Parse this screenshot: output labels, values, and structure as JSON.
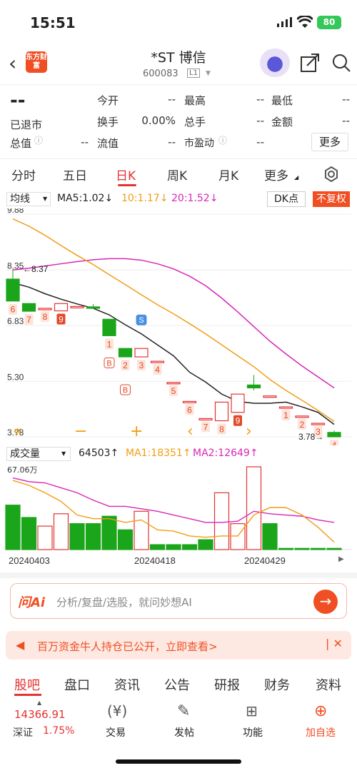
{
  "status": {
    "time": "15:51",
    "battery": "80"
  },
  "header": {
    "title": "*ST 博信",
    "code": "600083",
    "level": "L1",
    "logo_text": "东方财富"
  },
  "quote": {
    "price": "--",
    "status_text": "已退市",
    "fields": [
      {
        "label": "今开",
        "value": "--"
      },
      {
        "label": "最高",
        "value": "--"
      },
      {
        "label": "最低",
        "value": "--"
      },
      {
        "label": "换手",
        "value": "0.00%"
      },
      {
        "label": "总手",
        "value": "--"
      },
      {
        "label": "金额",
        "value": "--"
      },
      {
        "label": "总值",
        "value": "--"
      },
      {
        "label": "流值",
        "value": "--"
      },
      {
        "label": "市盈动",
        "value": "--"
      }
    ],
    "more_label": "更多"
  },
  "period_tabs": [
    "分时",
    "五日",
    "日K",
    "周K",
    "月K",
    "更多"
  ],
  "active_tab": "日K",
  "chart_controls": {
    "indicator": "均线",
    "ma5": "MA5:1.02↓",
    "ma10": "10:1.17↓",
    "ma20": "20:1.52↓",
    "dk": "DK点",
    "adjust": "不复权"
  },
  "volume_controls": {
    "indicator": "成交量",
    "vol": "64503↑",
    "ma1": "MA1:18351↑",
    "ma2": "MA2:12649↑",
    "max_label": "67.06万"
  },
  "chart_data": [
    {
      "type": "candlestick",
      "title": "",
      "price_axis_labels": [
        "9.88",
        "8.35",
        "6.83",
        "5.30",
        "3.78"
      ],
      "annotations": {
        "high_marker": "8.37",
        "low_marker": "3.78"
      },
      "candles": [
        {
          "open": 8.1,
          "high": 8.37,
          "low": 7.5,
          "close": 7.5,
          "label": "6"
        },
        {
          "open": 7.43,
          "high": 7.43,
          "low": 7.22,
          "close": 7.22,
          "label": "7"
        },
        {
          "open": 7.3,
          "high": 7.3,
          "low": 7.3,
          "close": 7.3,
          "label": "8"
        },
        {
          "open": 7.23,
          "high": 7.43,
          "low": 7.23,
          "close": 7.43,
          "label": "9"
        },
        {
          "open": 7.35,
          "high": 7.35,
          "low": 7.35,
          "close": 7.35,
          "label": ""
        },
        {
          "open": 7.34,
          "high": 7.42,
          "low": 7.3,
          "close": 7.3,
          "label": ""
        },
        {
          "open": 7.0,
          "high": 7.0,
          "low": 6.55,
          "close": 6.55,
          "label": "1"
        },
        {
          "open": 6.2,
          "high": 6.2,
          "low": 5.97,
          "close": 5.97,
          "label": "2"
        },
        {
          "open": 5.97,
          "high": 6.2,
          "low": 5.97,
          "close": 6.2,
          "label": "3"
        },
        {
          "open": 5.85,
          "high": 5.85,
          "low": 5.85,
          "close": 5.85,
          "label": "4"
        },
        {
          "open": 5.27,
          "high": 5.27,
          "low": 5.27,
          "close": 5.27,
          "label": "5"
        },
        {
          "open": 4.75,
          "high": 4.75,
          "low": 4.75,
          "close": 4.75,
          "label": "6"
        },
        {
          "open": 4.28,
          "high": 4.28,
          "low": 4.28,
          "close": 4.28,
          "label": "7"
        },
        {
          "open": 4.22,
          "high": 4.73,
          "low": 4.22,
          "close": 4.73,
          "label": "8"
        },
        {
          "open": 4.45,
          "high": 4.95,
          "low": 4.45,
          "close": 4.95,
          "label": "9"
        },
        {
          "open": 5.2,
          "high": 5.47,
          "low": 5.05,
          "close": 5.12,
          "label": ""
        },
        {
          "open": 4.9,
          "high": 4.9,
          "low": 4.9,
          "close": 4.9,
          "label": ""
        },
        {
          "open": 4.6,
          "high": 4.6,
          "low": 4.6,
          "close": 4.6,
          "label": "1"
        },
        {
          "open": 4.35,
          "high": 4.35,
          "low": 4.35,
          "close": 4.35,
          "label": "2"
        },
        {
          "open": 4.15,
          "high": 4.15,
          "low": 4.15,
          "close": 4.15,
          "label": "3"
        },
        {
          "open": 3.9,
          "high": 3.95,
          "low": 3.78,
          "close": 3.78,
          "label": "4"
        }
      ],
      "ma5": [
        8.0,
        7.88,
        7.7,
        7.55,
        7.42,
        7.3,
        7.12,
        6.85,
        6.6,
        6.3,
        6.0,
        5.55,
        5.28,
        4.95,
        4.75,
        4.7,
        4.7,
        4.73,
        4.6,
        4.45,
        4.12
      ],
      "ma10": [
        9.75,
        9.55,
        9.3,
        9.02,
        8.75,
        8.5,
        8.22,
        7.95,
        7.67,
        7.4,
        7.15,
        6.88,
        6.6,
        6.3,
        6.0,
        5.7,
        5.35,
        5.05,
        4.78,
        4.5,
        4.2
      ],
      "ma20": [
        8.35,
        8.4,
        8.46,
        8.52,
        8.58,
        8.63,
        8.66,
        8.66,
        8.62,
        8.52,
        8.38,
        8.18,
        7.92,
        7.58,
        7.2,
        6.8,
        6.4,
        6.05,
        5.72,
        5.42,
        5.12
      ],
      "signals": [
        "B",
        "B",
        "S"
      ]
    },
    {
      "type": "bar",
      "title": "",
      "ylabel_max": "67.06万",
      "x_tick_labels": [
        "20240403",
        "20240418",
        "20240429"
      ],
      "values": [
        36,
        26,
        19,
        29,
        21,
        21,
        27,
        16,
        31,
        4,
        4,
        4,
        8,
        46,
        21,
        67,
        21,
        1,
        1,
        1,
        1
      ],
      "up": [
        false,
        false,
        true,
        true,
        false,
        false,
        false,
        false,
        true,
        false,
        false,
        false,
        false,
        true,
        true,
        true,
        false,
        false,
        false,
        false,
        false
      ],
      "ma1": [
        56,
        52,
        46,
        39,
        28,
        25,
        25,
        22,
        24,
        16,
        15,
        11,
        10,
        11,
        11,
        28,
        34,
        34,
        28,
        18,
        6
      ],
      "ma2": [
        58,
        55,
        54,
        50,
        46,
        40,
        35,
        35,
        33,
        31,
        28,
        25,
        22,
        22,
        23,
        31,
        29,
        28,
        27,
        24,
        22
      ]
    }
  ],
  "ai_bar": {
    "logo": "问Ai",
    "placeholder": "分析/复盘/选股，就问妙想AI"
  },
  "banner": {
    "text": "百万资金牛人持仓已公开，立即查看>"
  },
  "bottom_tabs": [
    "股吧",
    "盘口",
    "资讯",
    "公告",
    "研报",
    "财务",
    "资料"
  ],
  "bottom_nav": {
    "index_value": "14366.91",
    "index_name": "深证",
    "index_change": "1.75%",
    "items": [
      "交易",
      "发帖",
      "功能",
      "加自选"
    ]
  },
  "colors": {
    "up": "#e63232",
    "down": "#1aa51a",
    "ma5": "#222222",
    "ma10": "#f39c12",
    "ma20": "#d626b8"
  }
}
